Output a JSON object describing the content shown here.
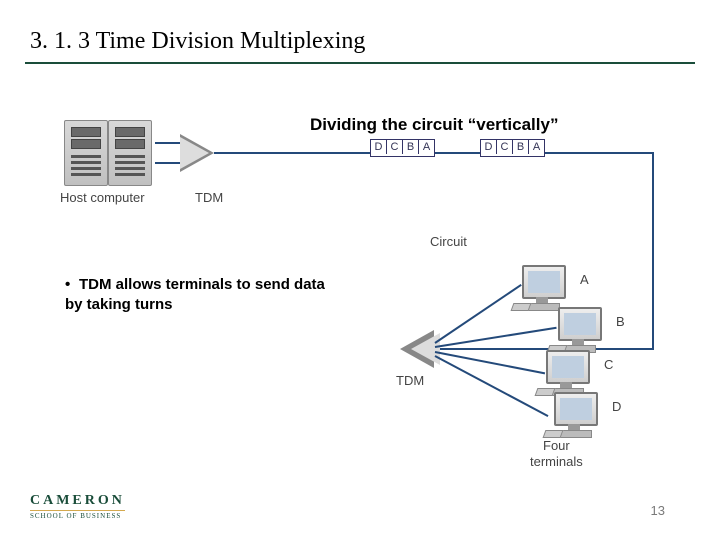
{
  "title": "3. 1. 3  Time Division Multiplexing",
  "subtitle": "Dividing the circuit “vertically”",
  "bullet": "TDM allows terminals to send data by taking turns",
  "labels": {
    "host": "Host computer",
    "tdm1": "TDM",
    "tdm2": "TDM",
    "circuit": "Circuit",
    "four_line1": "Four",
    "four_line2": "terminals"
  },
  "frames": [
    [
      "D",
      "C",
      "B",
      "A"
    ],
    [
      "D",
      "C",
      "B",
      "A"
    ]
  ],
  "terminals": [
    {
      "id": "A"
    },
    {
      "id": "B"
    },
    {
      "id": "C"
    },
    {
      "id": "D"
    }
  ],
  "logo": {
    "line1": "CAMERON",
    "line2": "School of Business"
  },
  "page": "13"
}
